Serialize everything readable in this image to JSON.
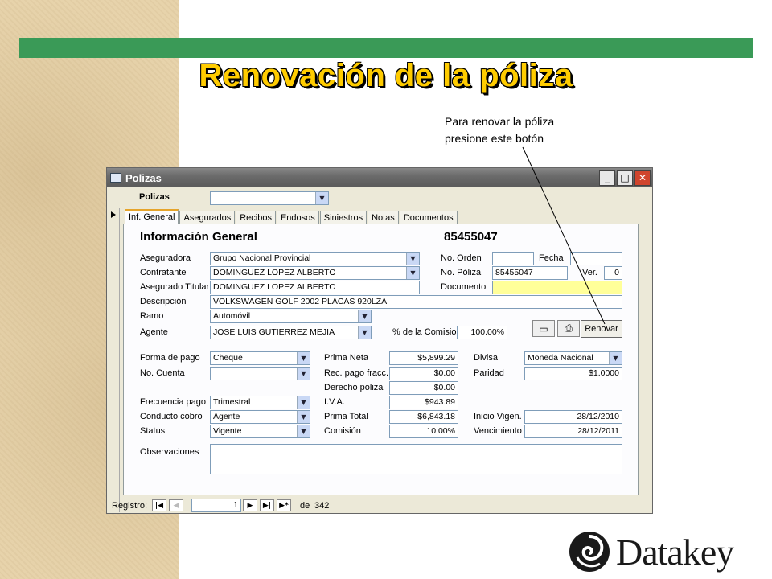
{
  "slide": {
    "title": "Renovación de la póliza",
    "callout_line1": "Para renovar la póliza",
    "callout_line2": "presione este botón",
    "logo_text": "Datakey",
    "colors": {
      "green_bar": "#3a9a57",
      "title": "#ffcc00",
      "highlight": "#ffff99"
    }
  },
  "window": {
    "title": "Polizas",
    "min_icon": "minimize-icon",
    "max_icon": "maximize-icon",
    "close_icon": "close-icon"
  },
  "top": {
    "label": "Polizas",
    "value": ""
  },
  "tabs": [
    "Inf. General",
    "Asegurados",
    "Recibos",
    "Endosos",
    "Siniestros",
    "Notas",
    "Documentos"
  ],
  "form": {
    "heading": "Información General",
    "policy_number_display": "85455047",
    "aseguradora_label": "Aseguradora",
    "aseguradora": "Grupo Nacional Provincial",
    "contratante_label": "Contratante",
    "contratante": "DOMINGUEZ LOPEZ ALBERTO",
    "titular_label": "Asegurado Titular",
    "titular": "DOMINGUEZ LOPEZ ALBERTO",
    "descripcion_label": "Descripción",
    "descripcion": "VOLKSWAGEN GOLF 2002 PLACAS 920LZA",
    "ramo_label": "Ramo",
    "ramo": "Automóvil",
    "agente_label": "Agente",
    "agente": "JOSE LUIS GUTIERREZ MEJIA",
    "comision_pct_label": "% de la Comision",
    "comision_pct": "100.00%",
    "orden_label": "No. Orden",
    "orden": "",
    "fecha_label": "Fecha",
    "fecha": "",
    "poliza_label": "No. Póliza",
    "poliza": "85455047",
    "ver_label": "Ver.",
    "ver": "0",
    "documento_label": "Documento",
    "documento": "",
    "renovar_label": "Renovar",
    "forma_pago_label": "Forma de pago",
    "forma_pago": "Cheque",
    "cuenta_label": "No. Cuenta",
    "cuenta": "",
    "frecuencia_label": "Frecuencia pago",
    "frecuencia": "Trimestral",
    "conducto_label": "Conducto cobro",
    "conducto": "Agente",
    "status_label": "Status",
    "status": "Vigente",
    "prima_neta_label": "Prima Neta",
    "prima_neta": "$5,899.29",
    "rec_pago_label": "Rec. pago fracc.",
    "rec_pago": "$0.00",
    "derecho_label": "Derecho poliza",
    "derecho": "$0.00",
    "iva_label": "I.V.A.",
    "iva": "$943.89",
    "prima_total_label": "Prima Total",
    "prima_total": "$6,843.18",
    "comision_label": "Comisión",
    "comision": "10.00%",
    "divisa_label": "Divisa",
    "divisa": "Moneda Nacional",
    "paridad_label": "Paridad",
    "paridad": "$1.0000",
    "inicio_label": "Inicio Vigen.",
    "inicio": "28/12/2010",
    "vencimiento_label": "Vencimiento",
    "vencimiento": "28/12/2011",
    "observaciones_label": "Observaciones",
    "observaciones": ""
  },
  "nav": {
    "label": "Registro:",
    "current": "1",
    "of_label": "de",
    "total": "342"
  }
}
